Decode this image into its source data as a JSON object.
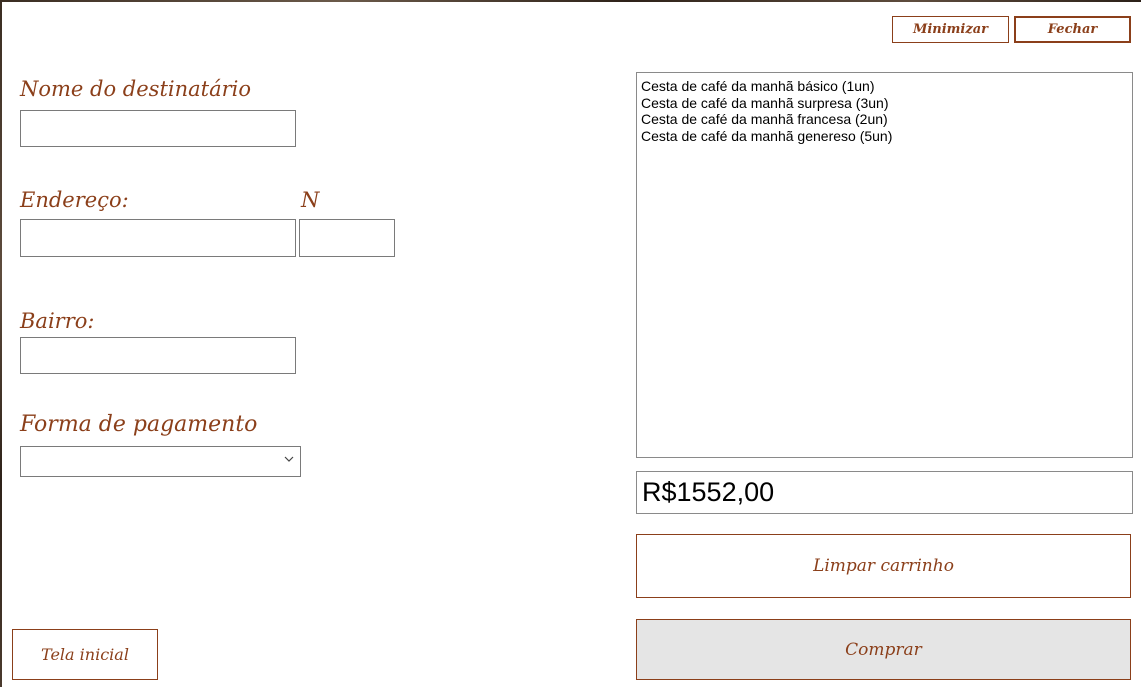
{
  "window": {
    "minimize_label": "Minimizar",
    "close_label": "Fechar"
  },
  "form": {
    "recipient_label": "Nome do destinatário",
    "recipient_value": "",
    "address_label": "Endereço:",
    "address_value": "",
    "number_label": "N",
    "number_value": "",
    "neighborhood_label": "Bairro:",
    "neighborhood_value": "",
    "payment_label": "Forma de pagamento",
    "payment_selected": ""
  },
  "cart": {
    "items": [
      "Cesta de café da manhã básico (1un)",
      "Cesta de café da manhã surpresa (3un)",
      "Cesta de café da manhã francesa (2un)",
      "Cesta de café da manhã genereso (5un)"
    ],
    "total": "R$1552,00",
    "clear_label": "Limpar carrinho",
    "buy_label": "Comprar"
  },
  "nav": {
    "home_label": "Tela inicial"
  },
  "colors": {
    "accent": "#8b3f1a",
    "buy_button_bg": "#e5e5e5"
  }
}
